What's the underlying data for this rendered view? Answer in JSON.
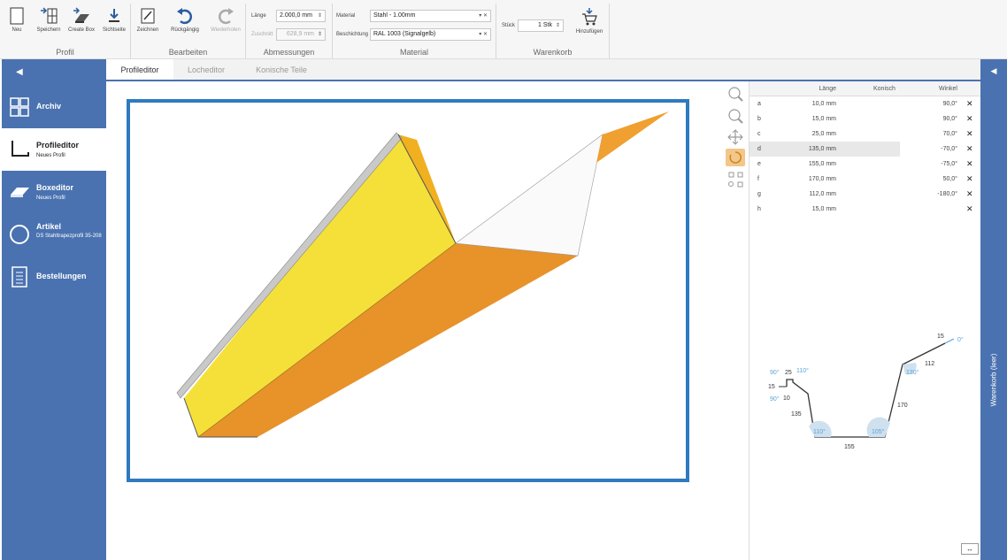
{
  "ribbon": {
    "buttons": {
      "neu": "Neu",
      "speichern": "Speichern",
      "create_box": "Create Box",
      "sichtseite": "Sichtseite",
      "zeichnen": "Zeichnen",
      "rueckgaengig": "Rückgängig",
      "wiederholen": "Wiederholen",
      "hinzufuegen": "Hinzufügen"
    },
    "groups": {
      "profil": "Profil",
      "bearbeiten": "Bearbeiten",
      "abmessungen": "Abmessungen",
      "material": "Material",
      "warenkorb": "Warenkorb"
    },
    "fields": {
      "laenge_label": "Länge",
      "laenge_value": "2.000,0 mm",
      "zuschnitt_label": "Zuschnitt",
      "zuschnitt_value": "628,9 mm",
      "material_label": "Material",
      "material_value": "Stahl - 1.00mm",
      "beschichtung_label": "Beschichtung",
      "beschichtung_value": "RAL 1003 (Signalgelb)",
      "stueck_label": "Stück",
      "stueck_value": "1 Stk"
    }
  },
  "sidebar": {
    "items": [
      {
        "title": "Archiv",
        "subtitle": "",
        "icon": "grid-icon"
      },
      {
        "title": "Profileditor",
        "subtitle": "Neues Profil",
        "icon": "profile-icon"
      },
      {
        "title": "Boxeditor",
        "subtitle": "Neues Profil",
        "icon": "box-icon"
      },
      {
        "title": "Artikel",
        "subtitle": "DS Stahltrapezprofil 35-208",
        "icon": "circle-icon"
      },
      {
        "title": "Bestellungen",
        "subtitle": "",
        "icon": "document-icon"
      }
    ]
  },
  "tabs": [
    "Profileditor",
    "Locheditor",
    "Konische Teile"
  ],
  "table": {
    "headers": [
      "Länge",
      "Konisch",
      "Winkel"
    ],
    "rows": [
      {
        "id": "a",
        "laenge": "10,0 mm",
        "winkel": "90,0°"
      },
      {
        "id": "b",
        "laenge": "15,0 mm",
        "winkel": "90,0°"
      },
      {
        "id": "c",
        "laenge": "25,0 mm",
        "winkel": "70,0°"
      },
      {
        "id": "d",
        "laenge": "135,0 mm",
        "winkel": "-70,0°"
      },
      {
        "id": "e",
        "laenge": "155,0 mm",
        "winkel": "-75,0°"
      },
      {
        "id": "f",
        "laenge": "170,0 mm",
        "winkel": "50,0°"
      },
      {
        "id": "g",
        "laenge": "112,0 mm",
        "winkel": "-180,0°"
      },
      {
        "id": "h",
        "laenge": "15,0 mm",
        "winkel": ""
      }
    ]
  },
  "profile_labels": {
    "l15_top": "15",
    "l0": "0°",
    "l112": "112",
    "l130": "130°",
    "l170": "170",
    "l105": "105°",
    "l155": "155",
    "l110b": "110°",
    "l135": "135",
    "l90a": "90°",
    "l25": "25",
    "l110a": "110°",
    "l15": "15",
    "l10": "10",
    "l90b": "90°"
  },
  "rightbar": {
    "label": "Warenkorb (leer)"
  },
  "colors": {
    "sidebar": "#4a72b0",
    "canvas_border": "#2f7abf",
    "yellow": "#f5e03a",
    "orange": "#e8922a"
  }
}
